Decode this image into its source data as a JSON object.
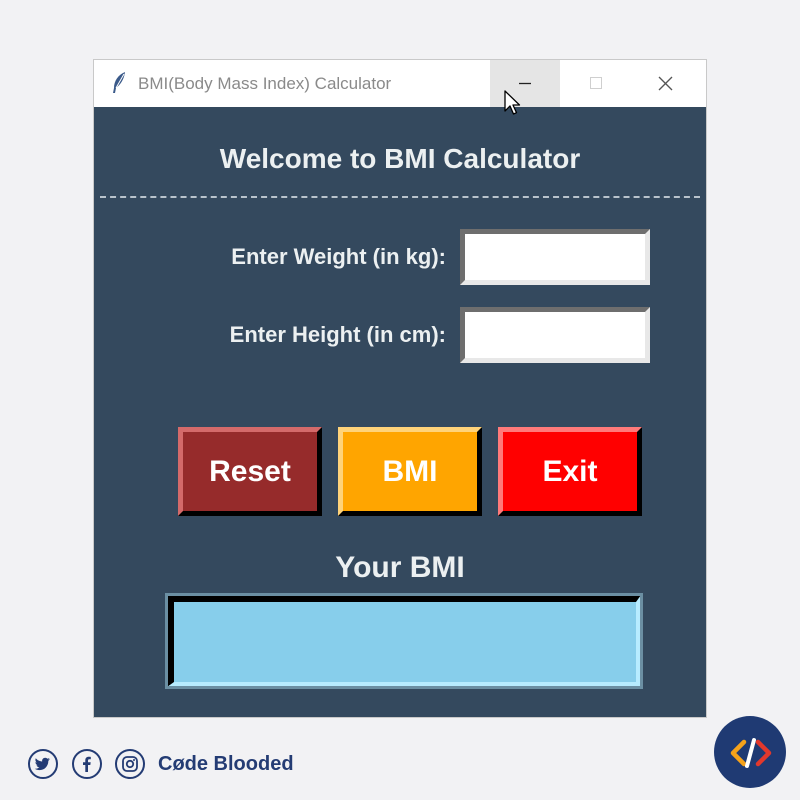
{
  "window": {
    "title": "BMI(Body Mass Index) Calculator",
    "controls": {
      "minimize": "minimize-icon",
      "maximize": "maximize-icon",
      "close": "close-icon"
    },
    "background": "#34495e"
  },
  "app": {
    "heading": "Welcome to BMI Calculator",
    "weight": {
      "label": "Enter Weight (in kg):",
      "value": ""
    },
    "height": {
      "label": "Enter Height (in cm):",
      "value": ""
    },
    "buttons": {
      "reset": {
        "label": "Reset",
        "color": "#962b2b"
      },
      "bmi": {
        "label": "BMI",
        "color": "#ffa500"
      },
      "exit": {
        "label": "Exit",
        "color": "#ff0000"
      }
    },
    "result": {
      "label": "Your BMI",
      "value": "",
      "color": "#87ceeb"
    }
  },
  "footer": {
    "social_icons": [
      "twitter-icon",
      "facebook-icon",
      "instagram-icon"
    ],
    "brand_name": "Cøde Blooded",
    "brand_logo": "code-brackets-icon",
    "brand_color": "#243c74"
  }
}
